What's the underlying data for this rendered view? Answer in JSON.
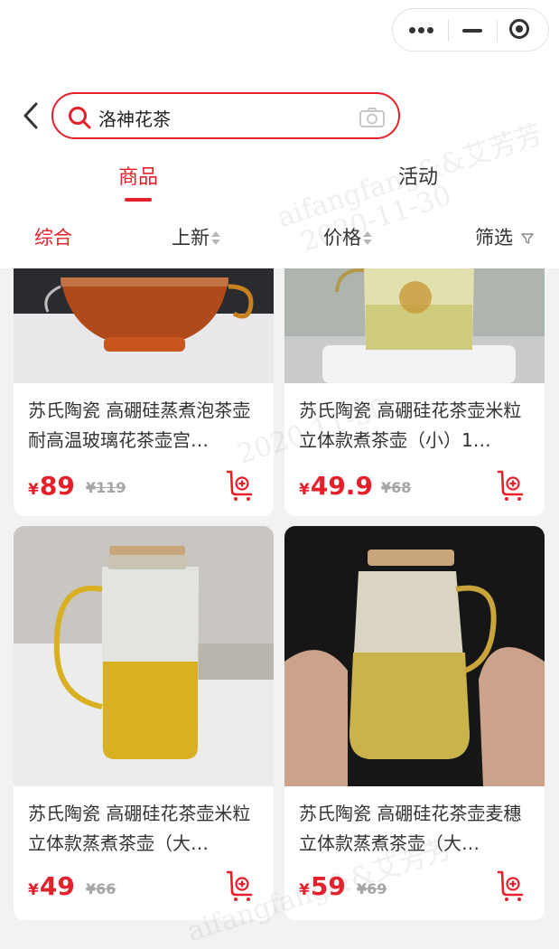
{
  "search": {
    "value": "洛神花茶"
  },
  "tabs": [
    {
      "label": "商品"
    },
    {
      "label": "活动"
    }
  ],
  "filters": {
    "comprehensive": "综合",
    "new": "上新",
    "price": "价格",
    "filter": "筛选"
  },
  "products": [
    {
      "title": "苏氏陶瓷 高硼硅蒸煮泡茶壶耐高温玻璃花茶壶宫…",
      "currency": "¥",
      "price": "89",
      "original_price": "¥119"
    },
    {
      "title": "苏氏陶瓷 高硼硅花茶壶米粒立体款煮茶壶（小）1…",
      "currency": "¥",
      "price": "49.9",
      "original_price": "¥68"
    },
    {
      "title": "苏氏陶瓷 高硼硅花茶壶米粒立体款蒸煮茶壶（大…",
      "currency": "¥",
      "price": "49",
      "original_price": "¥66"
    },
    {
      "title": "苏氏陶瓷 高硼硅花茶壶麦穗立体款蒸煮茶壶（大…",
      "currency": "¥",
      "price": "59",
      "original_price": "¥69"
    }
  ],
  "watermark": {
    "name": "aifangfang&&艾芳芳",
    "date": "2020-11-30"
  },
  "colors": {
    "accent": "#e5202a"
  }
}
